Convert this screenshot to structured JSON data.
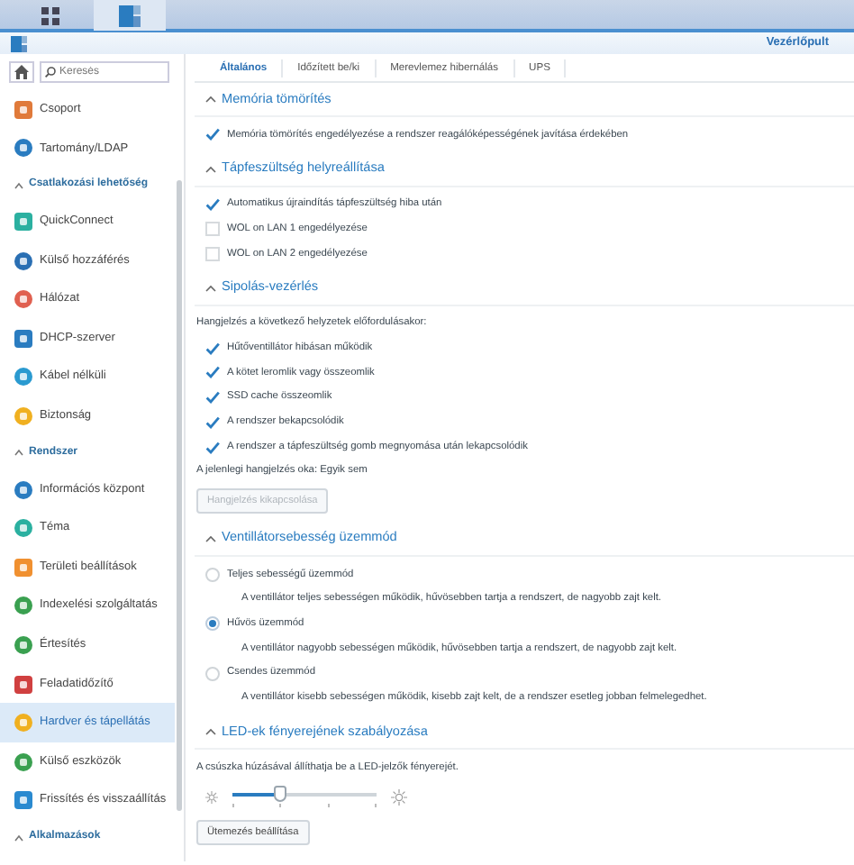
{
  "taskbar": {
    "buttons": [
      {
        "selected": false
      },
      {
        "selected": true
      }
    ]
  },
  "window": {
    "title": "Vezérlőpult"
  },
  "sidebar": {
    "search": {
      "placeholder": "Keresés"
    },
    "items": [
      {
        "kind": "item",
        "label": "Csoport",
        "selected": false
      },
      {
        "kind": "item",
        "label": "Tartomány/LDAP",
        "selected": false
      },
      {
        "kind": "section",
        "label": "Csatlakozási lehetőség"
      },
      {
        "kind": "item",
        "label": "QuickConnect",
        "selected": false
      },
      {
        "kind": "item",
        "label": "Külső hozzáférés",
        "selected": false
      },
      {
        "kind": "item",
        "label": "Hálózat",
        "selected": false
      },
      {
        "kind": "item",
        "label": "DHCP-szerver",
        "selected": false
      },
      {
        "kind": "item",
        "label": "Kábel nélküli",
        "selected": false
      },
      {
        "kind": "item",
        "label": "Biztonság",
        "selected": false
      },
      {
        "kind": "section",
        "label": "Rendszer"
      },
      {
        "kind": "item",
        "label": "Információs központ",
        "selected": false
      },
      {
        "kind": "item",
        "label": "Téma",
        "selected": false
      },
      {
        "kind": "item",
        "label": "Területi beállítások",
        "selected": false
      },
      {
        "kind": "item",
        "label": "Indexelési szolgáltatás",
        "selected": false
      },
      {
        "kind": "item",
        "label": "Értesítés",
        "selected": false
      },
      {
        "kind": "item",
        "label": "Feladatidőzítő",
        "selected": false
      },
      {
        "kind": "item",
        "label": "Hardver és tápellátás",
        "selected": true
      },
      {
        "kind": "item",
        "label": "Külső eszközök",
        "selected": false
      },
      {
        "kind": "item",
        "label": "Frissítés és visszaállítás",
        "selected": false
      },
      {
        "kind": "section",
        "label": "Alkalmazások"
      }
    ]
  },
  "tabs": [
    {
      "label": "Általános",
      "selected": true
    },
    {
      "label": "Időzített be/ki",
      "selected": false
    },
    {
      "label": "Merevlemez hibernálás",
      "selected": false
    },
    {
      "label": "UPS",
      "selected": false
    }
  ],
  "sections": [
    {
      "title": "Memória tömörítés",
      "items": [
        {
          "kind": "checkbox",
          "label": "Memória tömörítés engedélyezése a rendszer reagálóképességének javítása érdekében",
          "checked": true
        }
      ]
    },
    {
      "title": "Tápfeszültség helyreállítása",
      "items": [
        {
          "kind": "checkbox",
          "label": "Automatikus újraindítás tápfeszültség hiba után",
          "checked": true
        },
        {
          "kind": "checkbox",
          "label": "WOL on LAN 1 engedélyezése",
          "checked": false
        },
        {
          "kind": "checkbox",
          "label": "WOL on LAN 2 engedélyezése",
          "checked": false
        }
      ]
    },
    {
      "title": "Sipolás-vezérlés",
      "items": [
        {
          "kind": "text",
          "label": "Hangjelzés a következő helyzetek előfordulásakor:"
        },
        {
          "kind": "checkbox",
          "label": "Hűtőventillátor hibásan működik",
          "checked": true
        },
        {
          "kind": "checkbox",
          "label": "A kötet leromlik vagy összeomlik",
          "checked": true
        },
        {
          "kind": "checkbox",
          "label": "SSD cache összeomlik",
          "checked": true
        },
        {
          "kind": "checkbox",
          "label": "A rendszer bekapcsolódik",
          "checked": true
        },
        {
          "kind": "checkbox",
          "label": "A rendszer a tápfeszültség gomb megnyomása után lekapcsolódik",
          "checked": true
        },
        {
          "kind": "text",
          "label": "A jelenlegi hangjelzés oka: Egyik sem"
        },
        {
          "kind": "button",
          "label": "Hangjelzés kikapcsolása",
          "disabled": true
        }
      ]
    },
    {
      "title": "Ventillátorsebesség üzemmód",
      "items": [
        {
          "kind": "radio",
          "label": "Teljes sebességű üzemmód",
          "selected": false
        },
        {
          "kind": "note",
          "label": "A ventillátor teljes sebességen működik, hűvösebben tartja a rendszert, de nagyobb zajt kelt."
        },
        {
          "kind": "radio",
          "label": "Hűvös üzemmód",
          "selected": true
        },
        {
          "kind": "note",
          "label": "A ventillátor nagyobb sebességen működik, hűvösebben tartja a rendszert, de nagyobb zajt kelt."
        },
        {
          "kind": "radio",
          "label": "Csendes üzemmód",
          "selected": false
        },
        {
          "kind": "note",
          "label": "A ventillátor kisebb sebességen működik, kisebb zajt kelt, de a rendszer esetleg jobban felmelegedhet."
        }
      ]
    },
    {
      "title": "LED-ek fényerejének szabályozása",
      "items": [
        {
          "kind": "text",
          "label": "A csúszka húzásával állíthatja be a LED-jelzők fényerejét."
        },
        {
          "kind": "slider",
          "level": 0.33
        },
        {
          "kind": "button",
          "label": "Ütemezés beállítása",
          "disabled": false
        }
      ]
    }
  ]
}
